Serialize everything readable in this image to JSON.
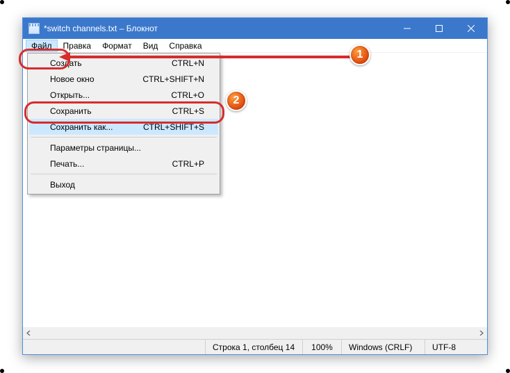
{
  "window": {
    "title": "*switch channels.txt – Блокнот"
  },
  "menubar": {
    "items": [
      "Файл",
      "Правка",
      "Формат",
      "Вид",
      "Справка"
    ],
    "active_index": 0
  },
  "dropdown": {
    "items": [
      {
        "label": "Создать",
        "shortcut": "CTRL+N"
      },
      {
        "label": "Новое окно",
        "shortcut": "CTRL+SHIFT+N"
      },
      {
        "label": "Открыть...",
        "shortcut": "CTRL+O"
      },
      {
        "label": "Сохранить",
        "shortcut": "CTRL+S"
      },
      {
        "label": "Сохранить как...",
        "shortcut": "CTRL+SHIFT+S"
      }
    ],
    "items2": [
      {
        "label": "Параметры страницы...",
        "shortcut": ""
      },
      {
        "label": "Печать...",
        "shortcut": "CTRL+P"
      }
    ],
    "items3": [
      {
        "label": "Выход",
        "shortcut": ""
      }
    ],
    "hover_index": 4
  },
  "statusbar": {
    "position": "Строка 1, столбец 14",
    "zoom": "100%",
    "lineending": "Windows (CRLF)",
    "encoding": "UTF-8"
  },
  "annotations": {
    "badge1": "1",
    "badge2": "2"
  }
}
